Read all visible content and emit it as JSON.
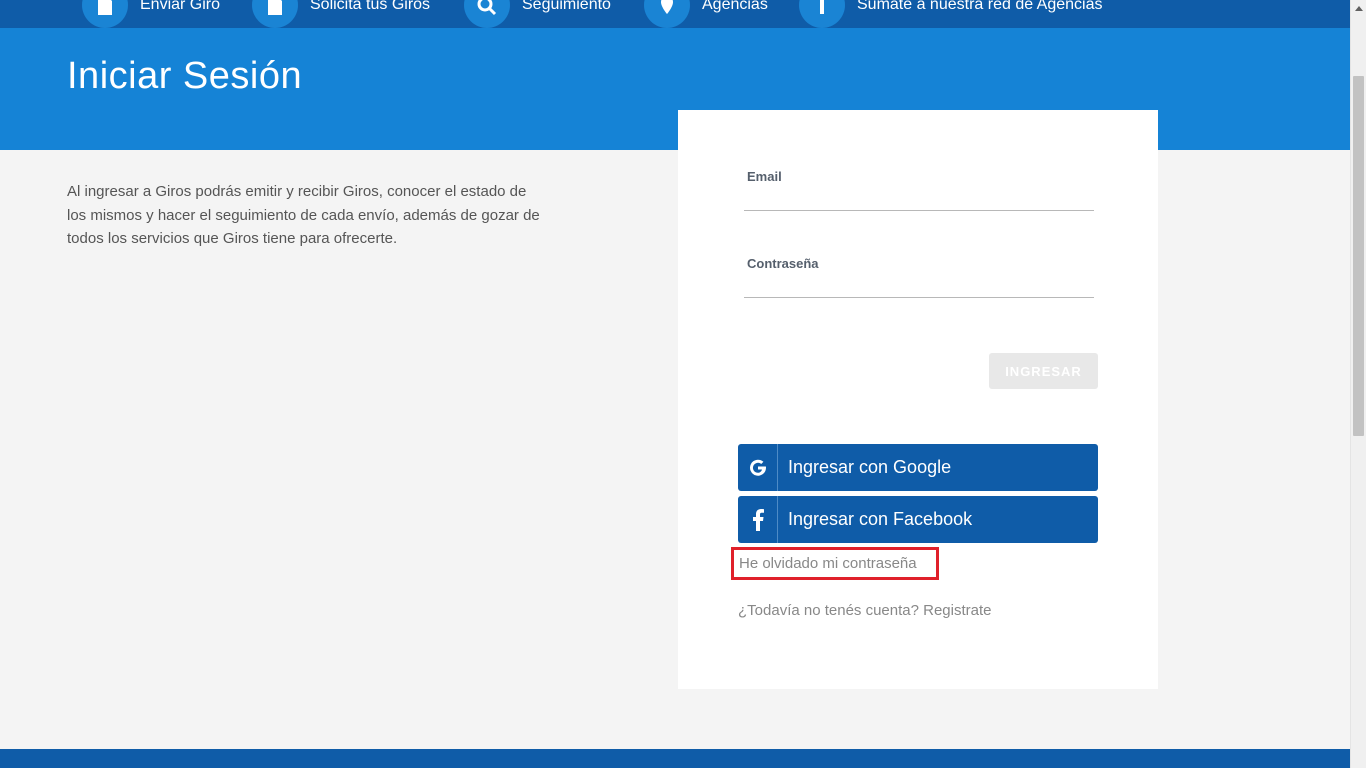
{
  "nav": {
    "items": [
      {
        "label": "Enviar Giro",
        "icon": "document-icon"
      },
      {
        "label": "Solicita tus Giros",
        "icon": "document-icon"
      },
      {
        "label": "Seguimiento",
        "icon": "search-icon"
      },
      {
        "label": "Agencias",
        "icon": "map-pin-icon"
      },
      {
        "label": "Sumate a nuestra red de Agencias",
        "icon": "info-icon"
      }
    ]
  },
  "hero": {
    "title": "Iniciar Sesión"
  },
  "intro": {
    "text": "Al ingresar a Giros podrás emitir y recibir Giros, conocer el estado de los mismos y hacer el seguimiento de cada envío, además de gozar de todos los servicios que Giros tiene para ofrecerte."
  },
  "form": {
    "email_label": "Email",
    "email_value": "",
    "password_label": "Contraseña",
    "password_value": "",
    "submit_label": "INGRESAR"
  },
  "social": {
    "google_label": "Ingresar con Google",
    "facebook_label": "Ingresar con Facebook"
  },
  "links": {
    "forgot": "He olvidado mi contraseña",
    "register": "¿Todavía no tenés cuenta? Registrate"
  },
  "colors": {
    "nav_bg": "#0f5ca8",
    "hero_bg": "#1583d6",
    "button_bg": "#0f5ca8",
    "highlight": "#e0202a"
  }
}
